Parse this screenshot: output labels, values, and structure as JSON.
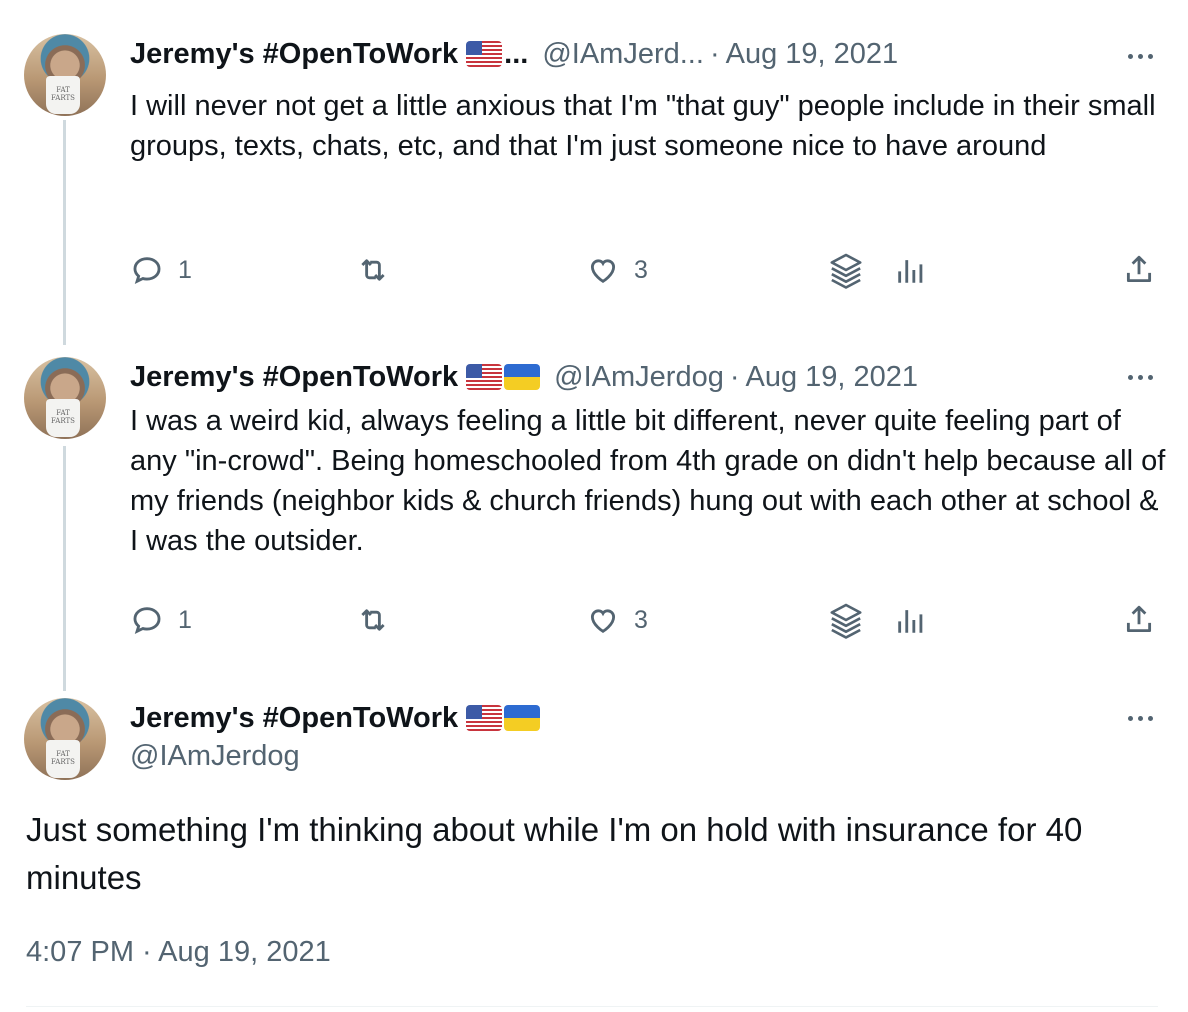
{
  "thread": [
    {
      "display_name": "Jeremy's #OpenToWork",
      "flags": [
        "us"
      ],
      "name_ellipsis": "...",
      "handle": "@IAmJerd...",
      "separator": "·",
      "date": "Aug 19, 2021",
      "text": "I will never not get a little anxious that I'm \"that guy\" people include in their small groups, texts, chats, etc, and that I'm just someone nice to have around",
      "replies": "1",
      "likes": "3"
    },
    {
      "display_name": "Jeremy's #OpenToWork",
      "flags": [
        "us",
        "ua"
      ],
      "handle": "@IAmJerdog",
      "separator": "·",
      "date": "Aug 19, 2021",
      "text": "I was a weird kid, always feeling a little bit different, never quite feeling part of any \"in-crowd\". Being homeschooled from 4th grade on didn't help because all of my friends (neighbor kids & church friends) hung out with each other at school & I was the outsider.",
      "replies": "1",
      "likes": "3"
    }
  ],
  "main_tweet": {
    "display_name": "Jeremy's #OpenToWork",
    "flags": [
      "us",
      "ua"
    ],
    "handle": "@IAmJerdog",
    "text": "Just something I'm thinking about while I'm on hold with insurance for 40 minutes",
    "timestamp": "4:07 PM · Aug 19, 2021"
  },
  "avatar_mug_text": "FAT\nFARTS",
  "colors": {
    "text_primary": "#0f1419",
    "text_secondary": "#536471",
    "thread_line": "#cfd9de",
    "divider": "#eff3f4"
  },
  "icons": [
    "reply-icon",
    "retweet-icon",
    "like-icon",
    "layers-icon",
    "views-icon",
    "share-icon",
    "more-icon"
  ]
}
